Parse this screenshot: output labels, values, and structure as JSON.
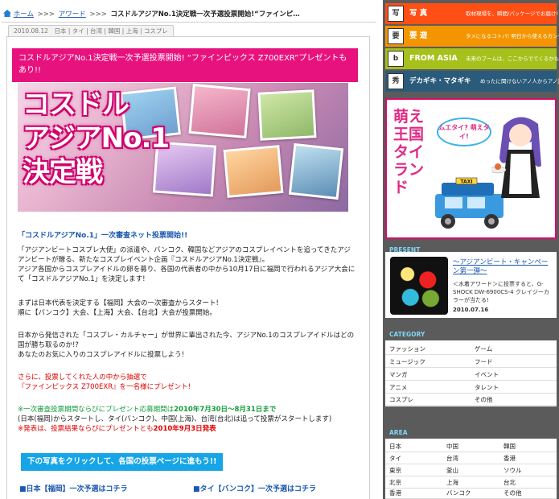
{
  "breadcrumb": {
    "home": "ホーム",
    "award": "アワード",
    "current": "コスドルアジアNo.1決定戦一次予選投票開始!“ファインピ…"
  },
  "article": {
    "meta": "2010.08.12　日本 | タイ | 台湾 | 韓国 | 上海 | コスプレ",
    "headline": "コスドルアジアNo.1決定戦一次予選投票開始! “ファインピックス Z700EXR”プレゼントもあり!!",
    "banner_title_lines": [
      "コスドル",
      "アジアNo.1",
      "決定戦"
    ],
    "subtitle": "「コスドルアジアNo.1」一次審査ネット投票開始!!",
    "para1": [
      "「アジアンビートコスプレ大使」の派遣や、バンコク、韓国などアジアのコスプレイベントを追ってきたアジアンビートが贈る、新たなコスプレイベント企画『コスドルアジアNo.1決定戦』。",
      "アジア各国からコスプレアイドルの卵を募り、各国の代表者の中から10月17日に福岡で行われるアジア大会にて「コスドルアジアNo.1」を決定します!"
    ],
    "para2": [
      "まずは日本代表を決定する【福岡】大会の一次審査からスタート!",
      "順に【バンコク】大会、【上海】大会、【台北】大会が投票開始。"
    ],
    "para3": [
      "日本から発信された「コスプレ・カルチャー」が世界に輩出された今、アジアNo.1のコスプレアイドルはどの国が勝ち取るのか!?",
      "あなたのお気に入りのコスプレアイドルに投票しよう!"
    ],
    "para4_red": [
      "さらに、投票してくれた人の中から抽選で",
      "『ファインピックス Z700EXR』を一名様にプレゼント!"
    ],
    "period_label": "※一次審査投票期間ならびにプレゼント応募期間は",
    "period_value": "2010年7月30日〜8月31日まで",
    "period_note": "(日本(福岡)からスタートし、タイ(バンコク)、中国(上海)、台湾(台北)は追って投票がスタートします)",
    "announce_label": "※発表は、投票結果ならびにプレゼントとも",
    "announce_value": "2010年9月3日発表",
    "cta": "下の写真をクリックして、各国の投票ページに進もう!!",
    "links": [
      "■日本【福岡】一次予選はコチラ",
      "■タイ【バンコク】一次予選はコチラ"
    ]
  },
  "sidebar": {
    "nav": [
      {
        "icon": "写",
        "label": "写 真",
        "sub": "取材現場を、瞬間/パッケージでお届け!"
      },
      {
        "icon": "要",
        "label": "要 遊",
        "sub": "タメになるコトバ! 明日から使えるカンタン!"
      },
      {
        "icon": "b",
        "label": "FROM ASIA",
        "sub": "未来のブームは、ここからでてくるかも!?"
      },
      {
        "icon": "秀",
        "label": "デカギキ・マタギキ",
        "sub": "めったに聞けないアノ人からアノ話!"
      }
    ],
    "promo": {
      "title": "萌え王国タイランド",
      "bubble": "ムエタイ? 萌えタイ!",
      "taxi": "TAXI"
    },
    "present": {
      "heading": "PRESENT",
      "title": "〜アジアンビート・キャンペーン第一弾〜",
      "desc": "＜水着アワード＞に投票すると、G-SHOCK DW-6900CS-4 クレイジーカラーが当たる!",
      "date": "2010.07.16"
    },
    "category": {
      "heading": "CATEGORY",
      "items": [
        "ファッション",
        "ゲーム",
        "ミュージック",
        "フード",
        "マンガ",
        "イベント",
        "アニメ",
        "タレント",
        "コスプレ",
        "その他"
      ]
    },
    "area": {
      "heading": "AREA",
      "items": [
        "日本",
        "中国",
        "韓国",
        "タイ",
        "台湾",
        "香港",
        "東京",
        "釜山",
        "ソウル",
        "北京",
        "上海",
        "台北",
        "香港",
        "バンコク",
        "その他"
      ]
    }
  }
}
